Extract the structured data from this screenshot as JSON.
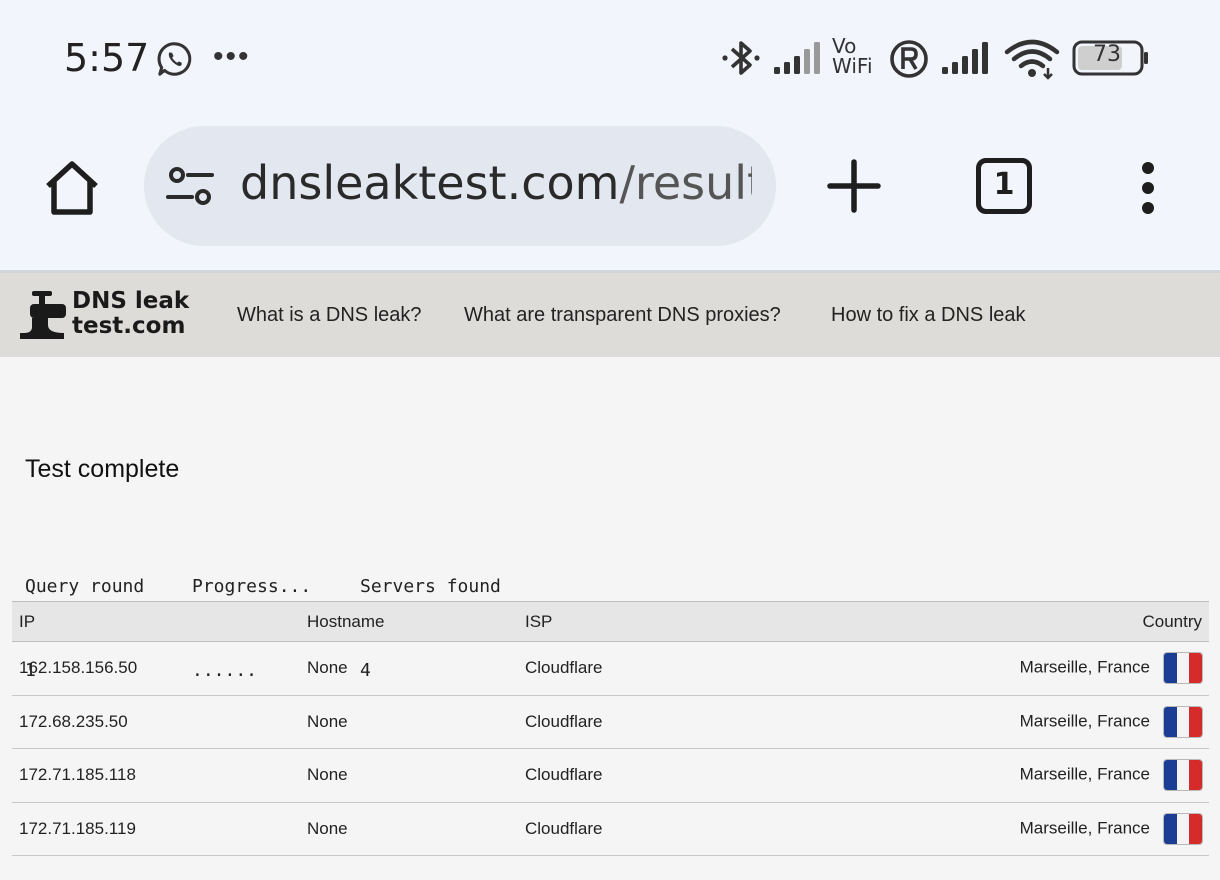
{
  "status_bar": {
    "time": "5:57",
    "notification_icons": [
      "whatsapp-icon",
      "more-dots"
    ],
    "more_dots": "•••",
    "vowifi_line1": "Vo",
    "vowifi_line2": "WiFi",
    "battery_level": "73",
    "system_icons": [
      "bluetooth-icon",
      "signal-icon",
      "vowifi-icon",
      "roaming-icon",
      "signal-icon",
      "wifi-icon",
      "battery-icon"
    ]
  },
  "browser": {
    "url_domain": "dnsleaktest.com",
    "url_path": "/results",
    "tab_count": "1"
  },
  "site_nav": {
    "logo_line1": "DNS leak",
    "logo_line2": "test.com",
    "links": [
      "What is a DNS leak?",
      "What are transparent DNS proxies?",
      "How to fix a DNS leak"
    ]
  },
  "test": {
    "title": "Test complete",
    "stats": [
      {
        "label": "Query round",
        "value": "1"
      },
      {
        "label": "Progress...",
        "value": "......"
      },
      {
        "label": "Servers found",
        "value": "4"
      }
    ]
  },
  "results": {
    "headers": [
      "IP",
      "Hostname",
      "ISP",
      "Country"
    ],
    "rows": [
      {
        "ip": "162.158.156.50",
        "hostname": "None",
        "isp": "Cloudflare",
        "country": "Marseille, France"
      },
      {
        "ip": "172.68.235.50",
        "hostname": "None",
        "isp": "Cloudflare",
        "country": "Marseille, France"
      },
      {
        "ip": "172.71.185.118",
        "hostname": "None",
        "isp": "Cloudflare",
        "country": "Marseille, France"
      },
      {
        "ip": "172.71.185.119",
        "hostname": "None",
        "isp": "Cloudflare",
        "country": "Marseille, France"
      }
    ]
  },
  "colors": {
    "flag_blue": "#1c3d94",
    "flag_white": "#f4f4f4",
    "flag_red": "#d62b2b"
  }
}
